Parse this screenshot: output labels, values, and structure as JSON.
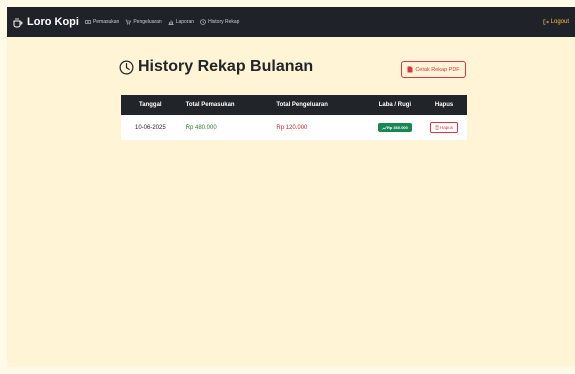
{
  "navbar": {
    "brand": "Loro Kopi",
    "links": [
      {
        "label": "Pemasukan",
        "icon": "money-icon"
      },
      {
        "label": "Pengeluaran",
        "icon": "cart-icon"
      },
      {
        "label": "Laporan",
        "icon": "chart-icon"
      },
      {
        "label": "History Rekap",
        "icon": "clock-icon"
      }
    ],
    "logout_label": "Logout"
  },
  "page": {
    "title": "History Rekap Bulanan",
    "print_button_label": "Cetak Rekap PDF"
  },
  "table": {
    "headers": [
      "Tanggal",
      "Total Pemasukan",
      "Total Pengeluaran",
      "Laba / Rugi",
      "Hapus"
    ],
    "rows": [
      {
        "tanggal": "10-06-2025",
        "pemasukan": "Rp 480.000",
        "pengeluaran": "Rp 120.000",
        "laba_rugi": "Rp 360.000",
        "hapus_label": "Hapus"
      }
    ]
  },
  "colors": {
    "navbar_bg": "#1f2329",
    "page_bg": "#fff4d6",
    "income": "#2e7d32",
    "expense": "#c62828",
    "profit_badge": "#198754",
    "danger": "#dc3545",
    "logout": "#f5c142"
  }
}
